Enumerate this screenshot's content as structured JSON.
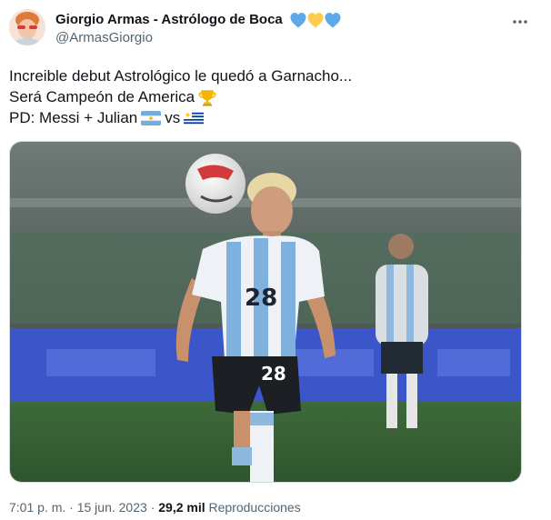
{
  "author": {
    "display_name": "Giorgio Armas - Astrólogo de Boca",
    "handle": "@ArmasGiorgio",
    "name_emojis": [
      "blue-heart-icon",
      "yellow-heart-icon",
      "blue-heart-icon"
    ],
    "heart_colors": {
      "blue": "#5da9e9",
      "yellow": "#ffcc4d"
    }
  },
  "tweet": {
    "line1": "Increible debut Astrológico le quedó a Garnacho...",
    "line2": "Será Campeón de America",
    "line2_emoji": "trophy-icon",
    "line3_prefix": "PD: Messi + Julian",
    "line3_vs": "vs",
    "flag1": "argentina-flag-icon",
    "flag2": "uruguay-flag-icon"
  },
  "media": {
    "jersey_number": "28"
  },
  "meta": {
    "time": "7:01 p. m.",
    "date": "15 jun. 2023",
    "views": "29,2 mil",
    "views_label": "Reproducciones",
    "separator": "·"
  },
  "colors": {
    "text_primary": "#0f1419",
    "text_secondary": "#536471",
    "border": "#cfd9de"
  }
}
